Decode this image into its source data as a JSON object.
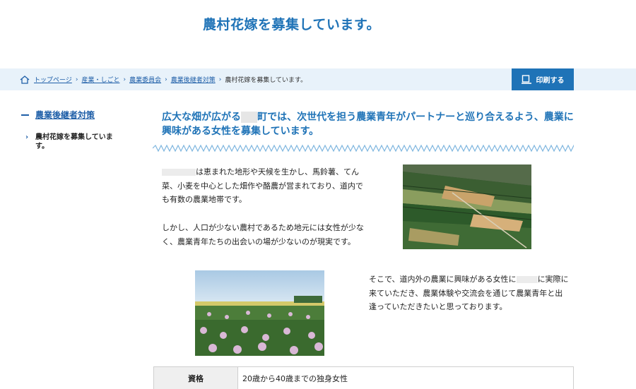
{
  "page": {
    "title": "農村花嫁を募集しています。"
  },
  "breadcrumb": {
    "items": [
      "トップページ",
      "産業・しごと",
      "農業委員会",
      "農業後継者対策"
    ],
    "current": "農村花嫁を募集しています。",
    "separator": "›"
  },
  "print_button": {
    "label": "印刷する"
  },
  "sidebar": {
    "heading": "農業後継者対策",
    "items": [
      {
        "label": "農村花嫁を募集しています。"
      }
    ]
  },
  "content": {
    "lead_before": "広大な畑が広がる",
    "lead_masked": "▯▯▯",
    "lead_after": "町では、次世代を担う農業青年がパートナーと巡り合えるよう、農業に興味がある女性を募集しています。",
    "paragraph1": "は恵まれた地形や天候を生かし、馬鈴薯、てん菜、小麦を中心とした畑作や酪農が営まれており、道内でも有数の農業地帯です。",
    "paragraph2": "しかし、人口が少ない農村であるため地元には女性が少なく、農業青年たちの出会いの場が少ないのが現実です。",
    "paragraph3_before": "そこで、道内外の農業に興味がある女性に",
    "paragraph3_after": "に実際に来ていただき、農業体験や交流会を通じて農業青年と出逢っていただきたいと思っております。",
    "photo1_alt": "aerial-farmland-photo",
    "photo2_alt": "potato-flower-field-photo"
  },
  "table": {
    "rows": [
      {
        "key": "資格",
        "value": "20歳から40歳までの独身女性"
      }
    ]
  },
  "colors": {
    "accent": "#1f73b7",
    "breadcrumb_bg": "#e8f2fa",
    "table_header_bg": "#efefef"
  }
}
